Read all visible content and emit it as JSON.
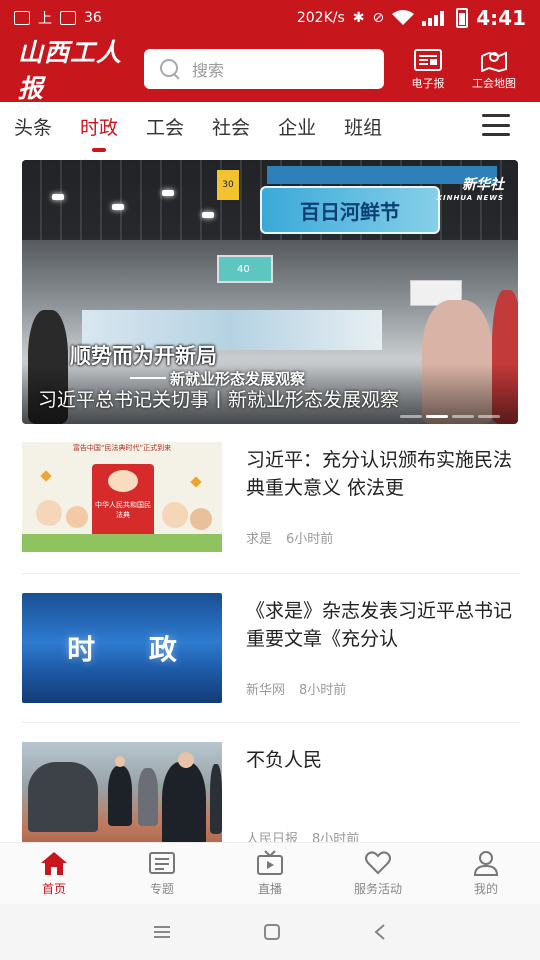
{
  "status_bar": {
    "net_speed": "202K/s",
    "time": "4:41",
    "left_text": "上",
    "left_number": "36"
  },
  "header": {
    "logo_text": "山西工人报",
    "search_placeholder": "搜索",
    "epaper_label": "电子报",
    "union_map_label": "工会地图"
  },
  "tabs": [
    {
      "label": "头条",
      "active": false
    },
    {
      "label": "时政",
      "active": true
    },
    {
      "label": "工会",
      "active": false
    },
    {
      "label": "社会",
      "active": false
    },
    {
      "label": "企业",
      "active": false
    },
    {
      "label": "班组",
      "active": false
    }
  ],
  "banner": {
    "caption": "习近平总书记关切事丨新就业形态发展观察",
    "image_text": {
      "headline": "顺势而为开新局",
      "subheadline": "新就业形态发展观察",
      "sign": "百日河鲜节",
      "source": "新华社",
      "source_en": "XINHUA NEWS",
      "screen_number": "40",
      "pillar_number": "30"
    }
  },
  "news": [
    {
      "title": "习近平：充分认识颁布实施民法典重大意义 依法更",
      "source": "求是",
      "time": "6小时前",
      "thumb_text": {
        "top": "富告中国“民法典时代”正式到来",
        "book": "中华人民共和国民法典"
      }
    },
    {
      "title": "《求是》杂志发表习近平总书记重要文章《充分认",
      "source": "新华网",
      "time": "8小时前",
      "thumb_text": {
        "label": "时 政"
      }
    },
    {
      "title": "不负人民",
      "source": "人民日报",
      "time": "8小时前"
    }
  ],
  "bottom_nav": [
    {
      "label": "首页",
      "icon": "home-icon",
      "active": true
    },
    {
      "label": "专题",
      "icon": "topic-icon",
      "active": false
    },
    {
      "label": "直播",
      "icon": "live-tv-icon",
      "active": false
    },
    {
      "label": "服务活动",
      "icon": "heart-icon",
      "active": false
    },
    {
      "label": "我的",
      "icon": "profile-icon",
      "active": false
    }
  ],
  "colors": {
    "brand_red": "#c8161d",
    "text_dark": "#222222",
    "text_muted": "#9a9a9a"
  }
}
